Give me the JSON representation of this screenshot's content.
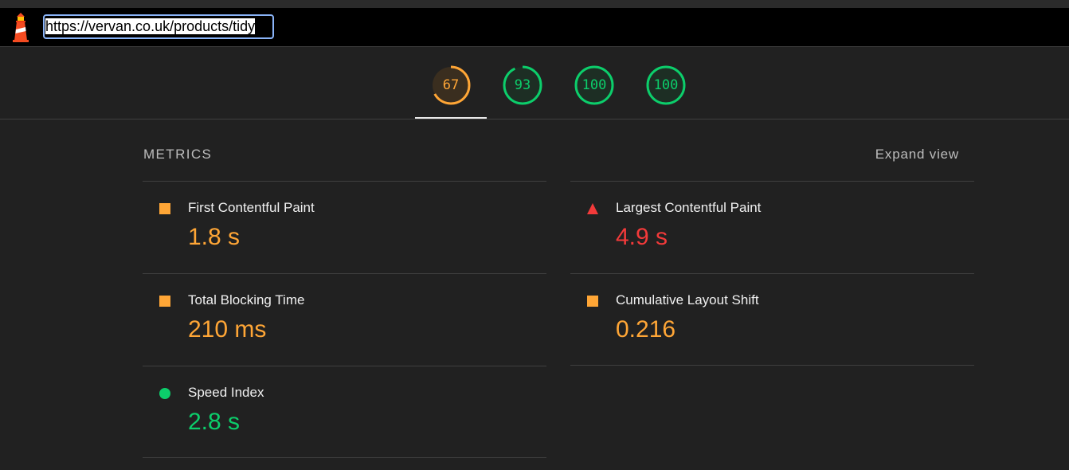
{
  "url_bar": {
    "url": "https://vervan.co.uk/products/tidy"
  },
  "colors": {
    "average": "#ffa636",
    "fail": "#f33a3a",
    "pass": "#0cce6b"
  },
  "gauges": [
    {
      "score": "67",
      "fraction": 0.67,
      "status": "average"
    },
    {
      "score": "93",
      "fraction": 0.93,
      "status": "pass"
    },
    {
      "score": "100",
      "fraction": 1.0,
      "status": "pass"
    },
    {
      "score": "100",
      "fraction": 1.0,
      "status": "pass"
    }
  ],
  "metrics_section": {
    "header": "METRICS",
    "expand_label": "Expand view",
    "items": [
      {
        "label": "First Contentful Paint",
        "value": "1.8 s",
        "status": "average",
        "icon": "square-icon"
      },
      {
        "label": "Largest Contentful Paint",
        "value": "4.9 s",
        "status": "fail",
        "icon": "triangle-icon"
      },
      {
        "label": "Total Blocking Time",
        "value": "210 ms",
        "status": "average",
        "icon": "square-icon"
      },
      {
        "label": "Cumulative Layout Shift",
        "value": "0.216",
        "status": "average",
        "icon": "square-icon"
      },
      {
        "label": "Speed Index",
        "value": "2.8 s",
        "status": "pass",
        "icon": "circle-icon"
      }
    ]
  }
}
